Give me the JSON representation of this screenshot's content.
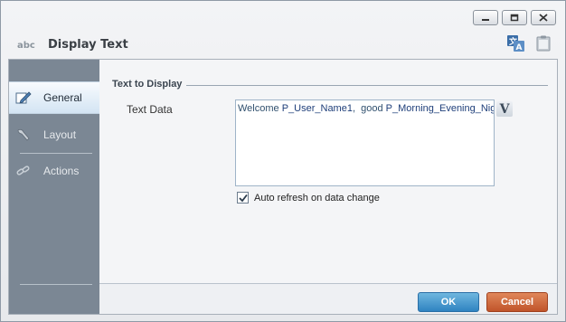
{
  "window": {
    "title": "Display Text",
    "title_icon": "abc-text-icon",
    "controls": [
      "minimize-icon",
      "restore-icon",
      "close-icon"
    ],
    "tools": [
      "translate-icon",
      "clipboard-icon"
    ]
  },
  "sidebar": {
    "items": [
      {
        "label": "General",
        "icon": "edit-pencil-icon",
        "active": true
      },
      {
        "label": "Layout",
        "icon": "wrench-icon",
        "active": false
      },
      {
        "label": "Actions",
        "icon": "link-chain-icon",
        "active": false
      }
    ]
  },
  "main": {
    "section_title": "Text to Display",
    "field_label": "Text Data",
    "text_value": {
      "segments": [
        {
          "text": "Welcome ",
          "param": false
        },
        {
          "text": "P_User_Name1",
          "param": true
        },
        {
          "text": ",  good ",
          "param": false
        },
        {
          "text": "P_Morning_Evening_Night",
          "param": true
        }
      ]
    },
    "variable_button_label": "V",
    "auto_refresh": {
      "label": "Auto refresh on data change",
      "checked": true
    }
  },
  "footer": {
    "ok_label": "OK",
    "cancel_label": "Cancel"
  },
  "colors": {
    "ok": "#2f83c1",
    "cancel": "#c0542a",
    "sidebar": "#7b8794"
  }
}
